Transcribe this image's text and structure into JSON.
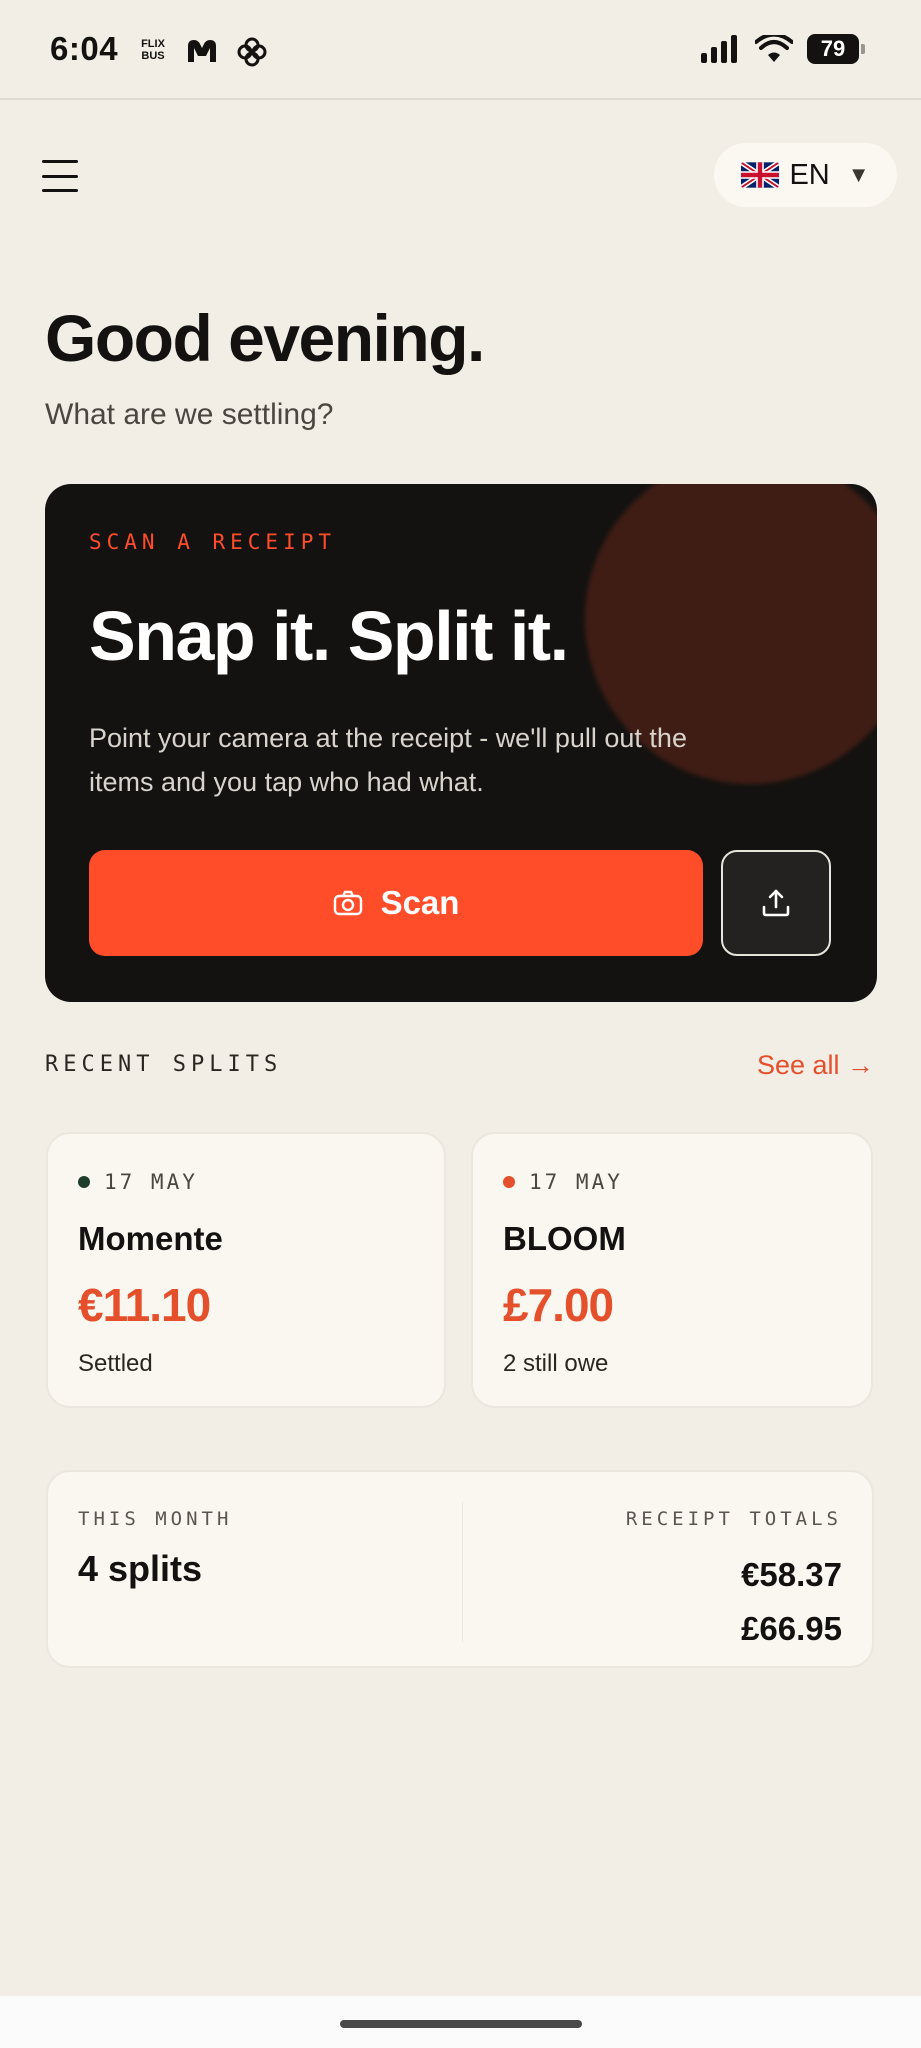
{
  "status_bar": {
    "time": "6:04",
    "notifications": [
      "flixbus-icon",
      "monzo-icon",
      "fan-icon"
    ],
    "flixbus_label": "FLIX BUS",
    "battery": "79"
  },
  "header": {
    "menu_icon": "hamburger-icon",
    "language": {
      "flag": "uk-flag-icon",
      "code": "EN",
      "caret": "▼"
    }
  },
  "greeting": {
    "title": "Good evening.",
    "subtitle": "What are we settling?"
  },
  "scan_card": {
    "eyebrow": "SCAN A RECEIPT",
    "title": "Snap it. Split it.",
    "description": "Point your camera at the receipt - we'll pull out the items and you tap who had what.",
    "scan_label": "Scan",
    "scan_icon": "camera-icon",
    "upload_icon": "upload-icon"
  },
  "recent": {
    "label": "RECENT SPLITS",
    "see_all": "See all →",
    "items": [
      {
        "date": "17 MAY",
        "dot_color": "#1f3d2b",
        "name": "Momente",
        "amount": "€11.10",
        "status": "Settled"
      },
      {
        "date": "17 MAY",
        "dot_color": "#e4502c",
        "name": "BLOOM",
        "amount": "£7.00",
        "status": "2 still owe"
      }
    ]
  },
  "month": {
    "label": "THIS MONTH",
    "value": "4 splits",
    "totals_label": "RECEIPT TOTALS",
    "totals": [
      "€58.37",
      "£66.95"
    ]
  },
  "colors": {
    "accent": "#ff4d2a",
    "background": "#f2eee6",
    "card_dark": "#141210"
  }
}
